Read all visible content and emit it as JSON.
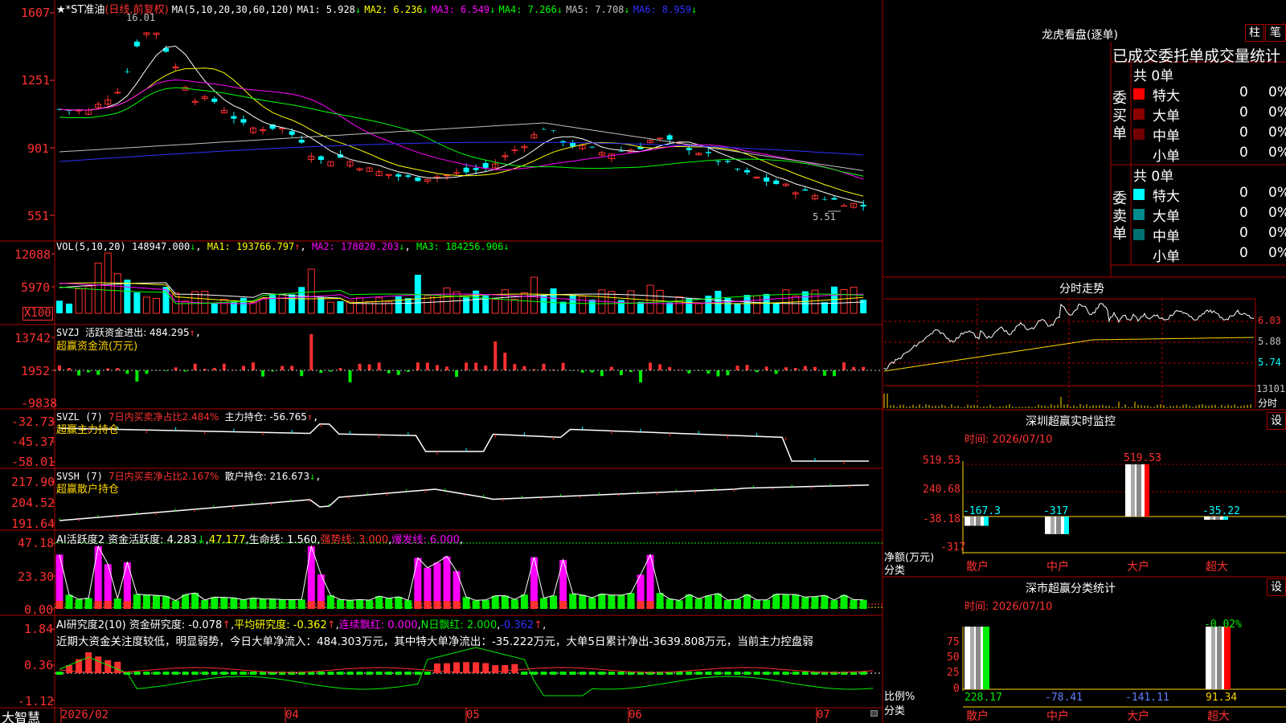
{
  "colors": {
    "up": "#ff3030",
    "down": "#00ffff",
    "ma1": "#ffffff",
    "ma2": "#ffff00",
    "ma3": "#ff00ff",
    "ma4": "#00ff00",
    "ma5": "#c0c0c0",
    "ma6": "#3030ff",
    "frame": "#b00000",
    "green": "#00ee00",
    "yellow": "#ffd700",
    "magenta": "#ff00ff"
  },
  "main": {
    "title": "★*ST准油",
    "period": "(日线,前复权)",
    "ma_label": "MA(5,10,20,30,60,120)",
    "ma": [
      {
        "text": "MA1: 5.928",
        "arrow": "↓"
      },
      {
        "text": "MA2: 6.236",
        "arrow": "↓"
      },
      {
        "text": "MA3: 6.549",
        "arrow": "↓"
      },
      {
        "text": "MA4: 7.266",
        "arrow": "↓"
      },
      {
        "text": "MA5: 7.708",
        "arrow": "↓"
      },
      {
        "text": "MA6: 8.959",
        "arrow": "↓"
      }
    ],
    "y_ticks": [
      "1607",
      "1251",
      "901",
      "551"
    ],
    "high_label": "16.01",
    "low_label": "5.51"
  },
  "vol": {
    "label": "VOL(5,10,20)",
    "v": "148947.000",
    "v_arrow": "↓",
    "ma1": "MA1: 193766.797",
    "ma1_arrow": "↑",
    "ma2": "MA2: 178020.203",
    "ma2_arrow": "↓",
    "ma3": "MA3: 184256.906",
    "ma3_arrow": "↓",
    "y_ticks": [
      "12088",
      "5970"
    ],
    "unit": "X100"
  },
  "svzj": {
    "label": "SVZJ",
    "text": "活跃资金进出: 484.295",
    "arrow": "↑",
    "sep": ",",
    "sub": "超赢资金流(万元)",
    "y_ticks": [
      "13742",
      "1952",
      "-9838"
    ]
  },
  "svzl": {
    "label": "SVZL (7)",
    "pct": "7日内买卖净占比2.484%",
    "hold": "主力持仓: -56.765",
    "arrow": "↑",
    "sep": ",",
    "sub": "超赢主力持仓",
    "y_ticks": [
      "-32.73",
      "-45.37",
      "-58.01"
    ]
  },
  "svsh": {
    "label": "SVSH (7)",
    "pct": "7日内买卖净占比2.167%",
    "hold": "散户持仓: 216.673",
    "arrow": "↓",
    "sep": ",",
    "sub": "超赢散户持仓",
    "y_ticks": [
      "217.90",
      "204.52",
      "191.64"
    ]
  },
  "ai1": {
    "label": "AI活跃度2",
    "active": "资金活跃度: 4.283",
    "arrow1": "↓",
    "val": "47.177",
    "life": "生命线: 1.560",
    "strong": "强势线: 3.000",
    "burst": "爆发线: 6.000",
    "y_ticks": [
      "47.18",
      "23.30",
      "0.00"
    ]
  },
  "ai2": {
    "label": "AI研究度2(10)",
    "research": "资金研究度: -0.078",
    "arrow1": "↑",
    "avg": "平均研究度: -0.362",
    "arrow2": "↑",
    "red": "连续飘红: 0.000",
    "nred": "N日飘红: 2.000",
    "neg": "-0.362",
    "arrow3": "↑",
    "note": "近期大资金关注度较低，明显弱势，今日大单净流入：484.303万元，其中特大单净流出：-35.222万元，大单5日累计净出-3639.808万元，当前主力控盘弱",
    "y_ticks": [
      "1.84",
      "0.36",
      "-1.12"
    ]
  },
  "xaxis": {
    "brand": "大智慧",
    "labels": [
      "2026/02",
      "04",
      "05",
      "06",
      "07"
    ]
  },
  "lhb": {
    "title": "龙虎看盘(逐单)",
    "btn1": "柱",
    "btn2": "笔",
    "header": "已成交委托单成交量统计",
    "buy_label": "委买单",
    "sell_label": "委卖单",
    "buy_total": "共 0单",
    "sell_total": "共 0单",
    "buy_rows": [
      {
        "name": "特大",
        "count": "0",
        "pct": "0%"
      },
      {
        "name": "大单",
        "count": "0",
        "pct": "0%"
      },
      {
        "name": "中单",
        "count": "0",
        "pct": "0%"
      },
      {
        "name": "小单",
        "count": "0",
        "pct": "0%"
      }
    ],
    "sell_rows": [
      {
        "name": "特大",
        "count": "0",
        "pct": "0%"
      },
      {
        "name": "大单",
        "count": "0",
        "pct": "0%"
      },
      {
        "name": "中单",
        "count": "0",
        "pct": "0%"
      },
      {
        "name": "小单",
        "count": "0",
        "pct": "0%"
      }
    ]
  },
  "intraday": {
    "title": "分时走势",
    "y_ticks": [
      "6.03",
      "5.88",
      "5.74"
    ],
    "vol_tick": "13101",
    "unit": "分时"
  },
  "monitor": {
    "title": "深圳超赢实时监控",
    "set": "设",
    "time": "时间: 2026/07/10",
    "y_ticks": [
      "519.53",
      "240.68",
      "-38.18",
      "-317"
    ],
    "axis_label": "净额(万元)",
    "cat_label": "分类",
    "bars": [
      {
        "cat": "散户",
        "value": -167.3,
        "label": "-167.3"
      },
      {
        "cat": "中户",
        "value": -317,
        "label": "-317"
      },
      {
        "cat": "大户",
        "value": 519.53,
        "label": "519.53"
      },
      {
        "cat": "超大",
        "value": -35.22,
        "label": "-35.22"
      }
    ]
  },
  "category": {
    "title": "深市超赢分类统计",
    "set": "设",
    "time": "时间: 2026/07/10",
    "y_ticks": [
      "75",
      "50",
      "25",
      "0"
    ],
    "axis_label": "比例%",
    "cat_label": "分类",
    "top_label": "-0.02%",
    "bars": [
      {
        "cat": "散户",
        "value": 228.17,
        "label": "228.17"
      },
      {
        "cat": "中户",
        "value": -78.41,
        "label": "-78.41"
      },
      {
        "cat": "大户",
        "value": -141.11,
        "label": "-141.11"
      },
      {
        "cat": "超大",
        "value": 91.34,
        "label": "91.34"
      }
    ]
  }
}
